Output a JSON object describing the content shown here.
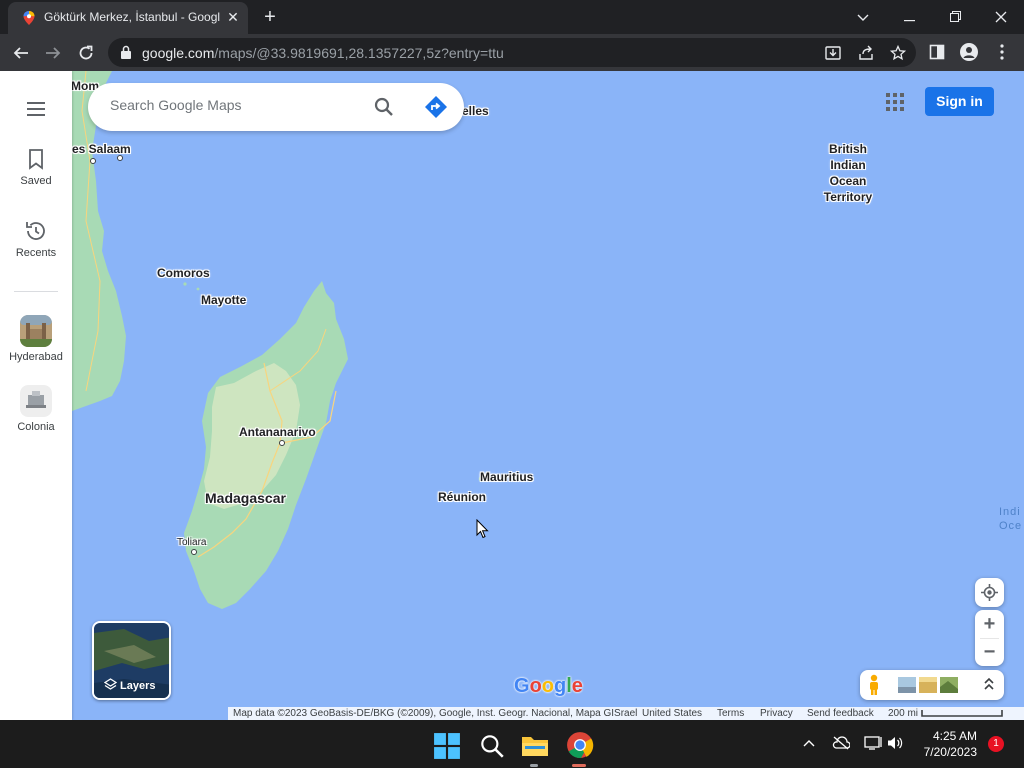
{
  "browser": {
    "tab_title": "Göktürk Merkez, İstanbul - Google Maps",
    "tab_close_icon": "close-icon",
    "new_tab": "+",
    "url_host": "google.com",
    "url_path": "/maps/@33.9819691,28.1357227,5z?entry=ttu",
    "window_controls": [
      "chevron-down-icon",
      "minimize-icon",
      "restore-icon",
      "close-icon"
    ]
  },
  "maps": {
    "search": {
      "placeholder": "Search Google Maps"
    },
    "sign_in_label": "Sign in",
    "rail": {
      "saved_label": "Saved",
      "recents_label": "Recents",
      "recent_places": [
        {
          "label": "Hyderabad"
        },
        {
          "label": "Colonia"
        }
      ]
    },
    "labels": {
      "mombasa": "Mom",
      "seychelles": "elles",
      "dar_es_salaam": "es Salaam",
      "comoros": "Comoros",
      "mayotte": "Mayotte",
      "antananarivo": "Antananarivo",
      "madagascar": "Madagascar",
      "toliara": "Toliara",
      "mauritius": "Mauritius",
      "reunion": "Réunion",
      "biot_1": "British",
      "biot_2": "Indian",
      "biot_3": "Ocean",
      "biot_4": "Territory",
      "indian_ocean_1": "Indi",
      "indian_ocean_2": "Oce"
    },
    "layers_label": "Layers",
    "google_logo": "Google",
    "footer": {
      "map_data": "Map data ©2023 GeoBasis-DE/BKG (©2009), Google, Inst. Geogr. Nacional, Mapa GISrael",
      "region": "United States",
      "terms": "Terms",
      "privacy": "Privacy",
      "feedback": "Send feedback",
      "scale": "200 mi"
    },
    "zoom_in": "+",
    "zoom_out": "−"
  },
  "taskbar": {
    "time": "4:25 AM",
    "date": "7/20/2023",
    "notification_count": "1"
  },
  "colors": {
    "water": "#8ab4f8",
    "land": "#a8dab5",
    "accent": "#1a73e8"
  }
}
